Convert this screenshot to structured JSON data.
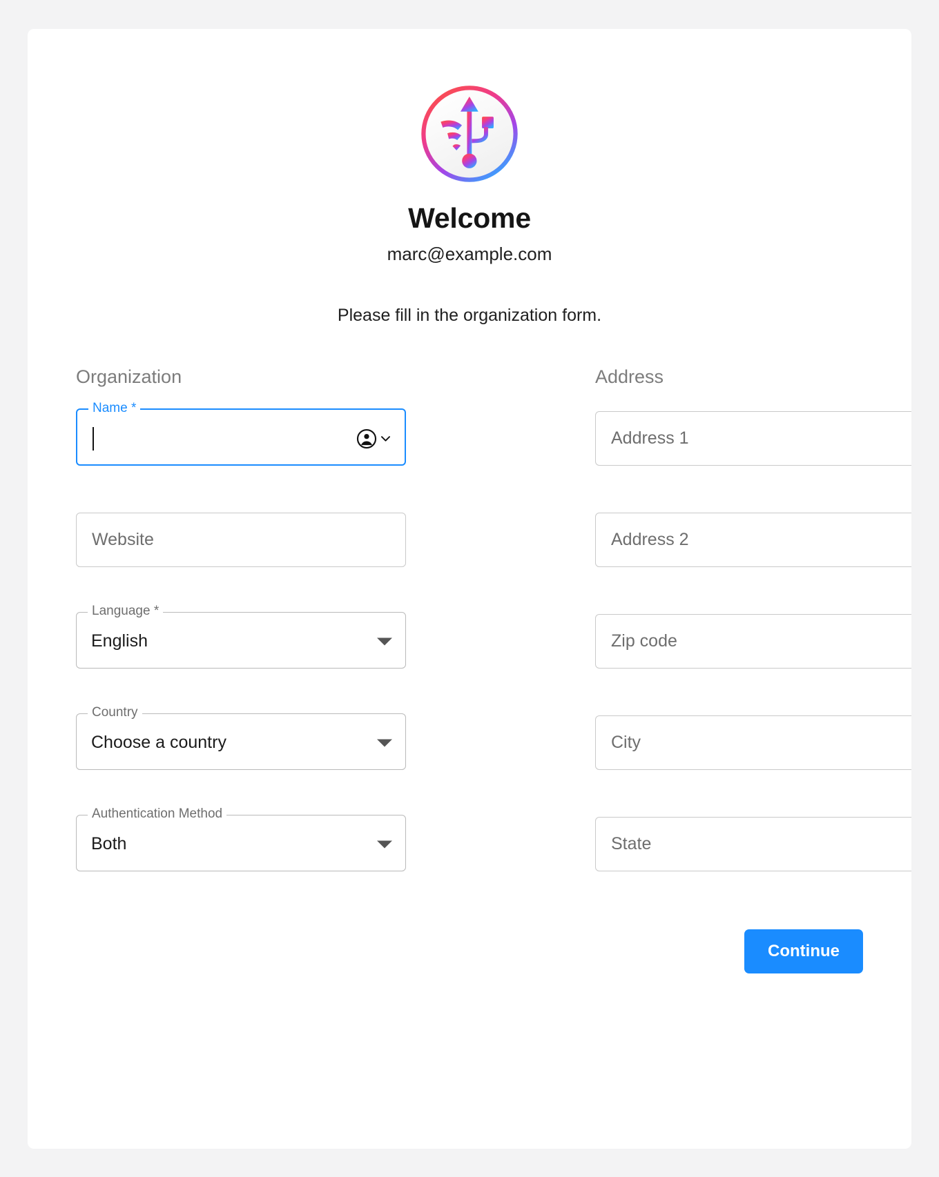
{
  "page": {
    "background_color": "#f3f3f4",
    "card_background": "#ffffff",
    "accent_color": "#1a8cff"
  },
  "branding": {
    "logo_icon": "imazing-usb-wifi-logo",
    "logo_gradient": [
      "#fb4e4e",
      "#ef3a8a",
      "#a244e8",
      "#31a8ff"
    ]
  },
  "header": {
    "title": "Welcome",
    "email": "marc@example.com",
    "instruction": "Please fill in the organization form."
  },
  "form": {
    "organization": {
      "section_title": "Organization",
      "fields": [
        {
          "name": "name",
          "label": "Name *",
          "value": "",
          "placeholder": "",
          "type": "text",
          "focused": true,
          "required": true,
          "trailing_icon": "person-circle-icon",
          "trailing_icon_secondary": "chevron-down-icon"
        },
        {
          "name": "website",
          "label": "",
          "value": "",
          "placeholder": "Website",
          "type": "text",
          "focused": false,
          "required": false
        },
        {
          "name": "language",
          "label": "Language *",
          "value": "English",
          "placeholder": "",
          "type": "select",
          "focused": false,
          "required": true,
          "trailing_icon": "dropdown-arrow-icon"
        },
        {
          "name": "country",
          "label": "Country",
          "value": "Choose a country",
          "placeholder": "",
          "type": "select",
          "focused": false,
          "required": false,
          "trailing_icon": "dropdown-arrow-icon"
        },
        {
          "name": "authentication_method",
          "label": "Authentication Method",
          "value": "Both",
          "placeholder": "",
          "type": "select",
          "focused": false,
          "required": false,
          "trailing_icon": "dropdown-arrow-icon"
        }
      ]
    },
    "address": {
      "section_title": "Address",
      "fields": [
        {
          "name": "address1",
          "label": "",
          "value": "",
          "placeholder": "Address 1",
          "type": "text"
        },
        {
          "name": "address2",
          "label": "",
          "value": "",
          "placeholder": "Address 2",
          "type": "text"
        },
        {
          "name": "zip_code",
          "label": "",
          "value": "",
          "placeholder": "Zip code",
          "type": "text"
        },
        {
          "name": "city",
          "label": "",
          "value": "",
          "placeholder": "City",
          "type": "text"
        },
        {
          "name": "state",
          "label": "",
          "value": "",
          "placeholder": "State",
          "type": "text"
        }
      ]
    }
  },
  "footer": {
    "continue_label": "Continue"
  }
}
